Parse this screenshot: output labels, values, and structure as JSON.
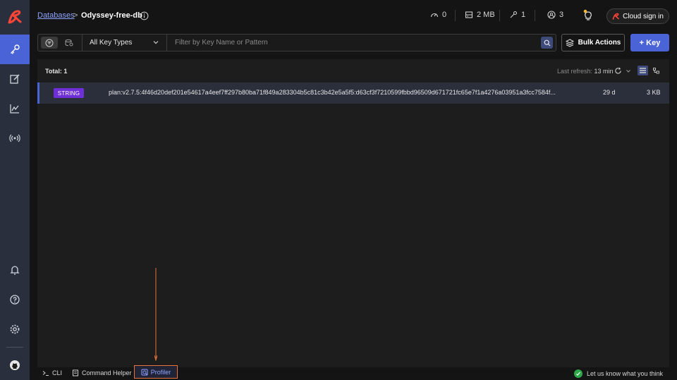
{
  "header": {
    "breadcrumb_link": "Databases",
    "breadcrumb_separator": ">",
    "db_name": "Odyssey-free-db",
    "stats": {
      "ops": "0",
      "memory": "2 MB",
      "keys": "1",
      "clients": "3"
    },
    "cloud_sign_in": "Cloud sign in"
  },
  "toolbar": {
    "key_type_selected": "All Key Types",
    "search_placeholder": "Filter by Key Name or Pattern",
    "bulk_actions_label": "Bulk Actions",
    "add_key_label": "+ Key"
  },
  "key_list": {
    "total_label": "Total: 1",
    "last_refresh_label": "Last refresh:",
    "last_refresh_value": "13 min",
    "rows": [
      {
        "type": "STRING",
        "name": "plan:v2.7.5:4f46d20def201e54617a4eef7ff297b80ba71f849a283304b5c81c3b42e5a5f5:d63cf3f7210599fbbd96509d671721fc65e7f1a4276a03951a3fcc7584f...",
        "ttl": "29 d",
        "size": "3 KB"
      }
    ]
  },
  "bottom": {
    "cli_label": "CLI",
    "command_helper_label": "Command Helper",
    "profiler_label": "Profiler",
    "feedback_label": "Let us know what you think"
  },
  "colors": {
    "accent": "#4a63d7",
    "string_badge": "#6f2fd6",
    "highlight": "#e8743a",
    "sidebar_bg": "#2a2f3d"
  }
}
